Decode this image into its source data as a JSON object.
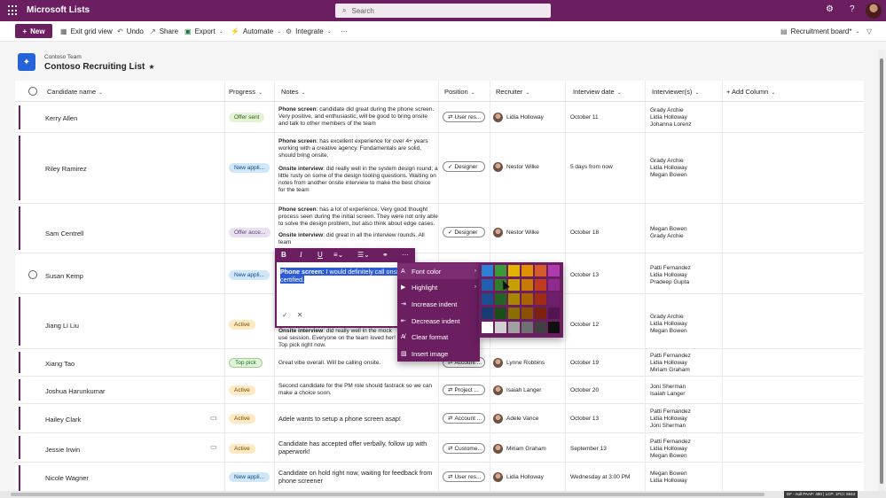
{
  "app": {
    "title": "Microsoft Lists"
  },
  "search": {
    "placeholder": "Search"
  },
  "commands": {
    "new": "New",
    "exit_grid": "Exit grid view",
    "undo": "Undo",
    "share": "Share",
    "export": "Export",
    "automate": "Automate",
    "integrate": "Integrate",
    "more": "···",
    "view": "Recruitment board*"
  },
  "list": {
    "team": "Contoso Team",
    "title": "Contoso Recruiting List",
    "star": "★"
  },
  "columns": {
    "name": "Candidate name",
    "progress": "Progress",
    "notes": "Notes",
    "position": "Position",
    "recruiter": "Recruiter",
    "date": "Interview date",
    "interviewers": "Interviewer(s)",
    "add": "+ Add Column"
  },
  "rows": [
    {
      "name": "Kerry Allen",
      "progress": "Offer sent",
      "notes": [
        {
          "bold": "Phone screen",
          "text": ": candidate did great during the phone screen. Very positive, and enthusiastic, will be good to bring onsite and talk to other members of the team"
        }
      ],
      "position": "User res...",
      "recruiter": "Lidia Holloway",
      "date": "October 11",
      "interviewers": [
        "Grady Archie",
        "Lidia Holloway",
        "Johanna Lorenz"
      ]
    },
    {
      "name": "Riley Ramirez",
      "progress": "New appli...",
      "notes": [
        {
          "bold": "Phone screen",
          "text": ": has excellent experience for over 4+ years working with a creative agency. Fundamentals are solid, should bring onsite."
        },
        {
          "bold": "Onsite interview",
          "text": ": did really well in the system design round; a little rusty on some of the design tooling questions. Waiting on notes from another onsite interview to make the best choice for the team"
        }
      ],
      "position": "Designer",
      "recruiter": "Nestor Wilke",
      "date": "5 days from now",
      "interviewers": [
        "Grady Archie",
        "Lidia Holloway",
        "Megan Bowen"
      ]
    },
    {
      "name": "Sam Centrell",
      "progress": "Offer acce...",
      "notes": [
        {
          "bold": "Phone screen",
          "text": ": has a lot of experience. Very good thought process seen during the initial screen. They were not only able to solve the design problem, but also think about edge cases."
        },
        {
          "bold": "Onsite interview",
          "text": ": did great in all the interview rounds. All team"
        }
      ],
      "position": "Designer",
      "recruiter": "Nestor Wilke",
      "date": "October 18",
      "interviewers": [
        "Megan Bowen",
        "Grady Archie"
      ]
    },
    {
      "name": "Susan Kemp",
      "progress": "New appli...",
      "notes": [],
      "position": "",
      "recruiter": "",
      "date": "October 13",
      "interviewers": [
        "Patti Fernandez",
        "Lidia Holloway",
        "Pradeep Gupta"
      ]
    },
    {
      "name": "Jiang Li Liu",
      "progress": "Active",
      "notes": [
        {
          "bold": "Onsite interview",
          "text": ": did really well in the mock use session. Everyone on the team loved her! Top pick right now."
        }
      ],
      "position": "",
      "recruiter": "",
      "date": "October 12",
      "interviewers": [
        "Grady Archie",
        "Lidia Holloway",
        "Megan Bowen"
      ]
    },
    {
      "name": "Xiang Tao",
      "progress": "Top pick",
      "notes": [
        {
          "bold": "",
          "text": "Great vibe overall. Will be calling onsite."
        }
      ],
      "position": "Account ...",
      "recruiter": "Lynne Robbins",
      "date": "October 19",
      "interviewers": [
        "Patti Fernandez",
        "Lidia Holloway",
        "Miriam Graham"
      ]
    },
    {
      "name": "Joshua Harunkumar",
      "progress": "Active",
      "notes": [
        {
          "bold": "",
          "text": "Second candidate for the PM role should fastrack so we can make a choice soon."
        }
      ],
      "position": "Project ...",
      "recruiter": "Isaiah Langer",
      "date": "October 20",
      "interviewers": [
        "Joni Sherman",
        "Isaiah Langer"
      ]
    },
    {
      "name": "Hailey Clark",
      "progress": "Active",
      "notes": [
        {
          "bold": "",
          "text": "Adele wants to setup a phone screen asap!"
        }
      ],
      "position": "Account ...",
      "recruiter": "Adele Vance",
      "date": "October 13",
      "interviewers": [
        "Patti Fernandez",
        "Lidia Holloway",
        "Joni Sherman"
      ]
    },
    {
      "name": "Jessie Irwin",
      "progress": "Active",
      "notes": [
        {
          "bold": "",
          "text": "Candidate has accepted offer verbally, follow up with paperwork!"
        }
      ],
      "position": "Custome...",
      "recruiter": "Miriam Graham",
      "date": "September 13",
      "interviewers": [
        "Patti Fernandez",
        "Lidia Holloway",
        "Megan Bowen"
      ]
    },
    {
      "name": "Nicole Wagner",
      "progress": "New appli...",
      "notes": [
        {
          "bold": "",
          "text": "Candidate on hold right now, waiting for feedback from phone screener"
        }
      ],
      "position": "User res...",
      "recruiter": "Lidia Holloway",
      "date": "Wednesday at 3:00 PM",
      "interviewers": [
        "Megan Bowen",
        "Lidia Holloway"
      ]
    }
  ],
  "editor": {
    "bold": "Phone screen:",
    "text": " I would definitely call onsi",
    "text2": "certified."
  },
  "menu": [
    "Font color",
    "Highlight",
    "Increase indent",
    "Decrease indent",
    "Clear format",
    "Insert image"
  ],
  "palette": [
    "#2e7fd6",
    "#3a9a3a",
    "#e0b400",
    "#e09000",
    "#d65a2a",
    "#b03bb0",
    "#1f5fb0",
    "#2d7d2d",
    "#c7a000",
    "#c97800",
    "#c23a1e",
    "#8f2a8f",
    "#1b4e8f",
    "#236323",
    "#a88700",
    "#a96300",
    "#a02c16",
    "#6e1f6e",
    "#153d70",
    "#1a4d1a",
    "#8a6f00",
    "#8a5100",
    "#7e2210",
    "#521752",
    "#ffffff",
    "#d0d0d0",
    "#a0a0a0",
    "#707070",
    "#404040",
    "#101010"
  ],
  "status": "DF - null   PAAP: 480 | LCP: 1FCI: 5944"
}
